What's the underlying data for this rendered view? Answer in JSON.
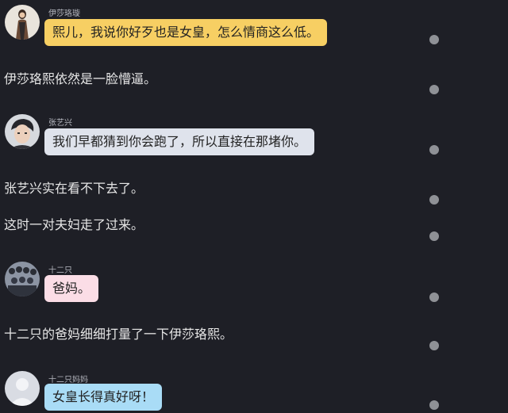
{
  "messages": [
    {
      "sender": "伊莎珞璇",
      "text": "熙儿，我说你好歹也是女皇，怎么情商这么低。",
      "avatar": "woman-standing-avatar",
      "bubble_color": "#f7cf63"
    },
    {
      "sender": "张艺兴",
      "text": "我们早都猜到你会跑了，所以直接在那堵你。",
      "avatar": "young-man-portrait-avatar",
      "bubble_color": "#dfe3ec"
    },
    {
      "sender": "十二只",
      "text": "爸妈。",
      "avatar": "group-photo-avatar",
      "bubble_color": "#fbdde6"
    },
    {
      "sender": "十二只妈妈",
      "text": "女皇长得真好呀！",
      "avatar": "default-person-avatar",
      "bubble_color": "#a9dcf6"
    }
  ],
  "narrations": [
    "伊莎珞熙依然是一脸懵逼。",
    "张艺兴实在看不下去了。",
    "这时一对夫妇走了过来。",
    "十二只的爸妈细细打量了一下伊莎珞熙。"
  ],
  "colors": {
    "background": "#1e1f26",
    "narration_text": "#e6e6e6",
    "sender_text": "#b3b5bd",
    "scroll_marker": "#8f9196"
  }
}
